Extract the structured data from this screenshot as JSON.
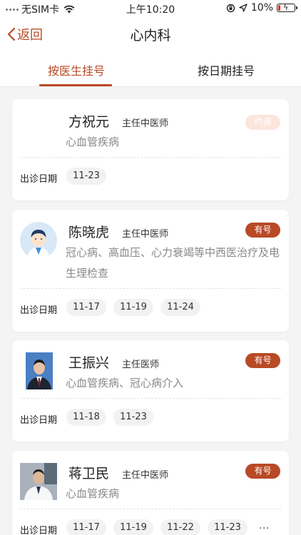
{
  "status": {
    "carrier": "无SIM卡",
    "time": "上午10:20",
    "battery": "10%",
    "battery_level": 0.1
  },
  "nav": {
    "back_label": "返回",
    "title": "心内科"
  },
  "tabs": [
    {
      "label": "按医生挂号",
      "active": true
    },
    {
      "label": "按日期挂号",
      "active": false
    }
  ],
  "date_label": "出诊日期",
  "doctors": [
    {
      "name": "方祝元",
      "title": "主任中医师",
      "badge": "约满",
      "specialty": "心血管疾病",
      "dates": [
        "11-23"
      ],
      "more": ""
    },
    {
      "name": "陈晓虎",
      "title": "主任中医师",
      "badge": "有号",
      "specialty": "冠心病、高血压、心力衰竭等中西医治疗及电生理检查",
      "dates": [
        "11-17",
        "11-19",
        "11-24"
      ],
      "more": ""
    },
    {
      "name": "王振兴",
      "title": "主任医师",
      "badge": "有号",
      "specialty": "心血管疾病、冠心病介入",
      "dates": [
        "11-18",
        "11-23"
      ],
      "more": ""
    },
    {
      "name": "蒋卫民",
      "title": "主任中医师",
      "badge": "有号",
      "specialty": "心血管疾病",
      "dates": [
        "11-17",
        "11-19",
        "11-22",
        "11-23"
      ],
      "more": "..."
    }
  ],
  "colors": {
    "accent": "#b84a26",
    "badge_full_bg": "#fbe5dc",
    "background": "#f4f4f4"
  },
  "icons": [
    "signal-dots-icon",
    "wifi-icon",
    "rotation-lock-icon",
    "location-arrow-icon",
    "battery-icon",
    "back-chevron-icon"
  ]
}
